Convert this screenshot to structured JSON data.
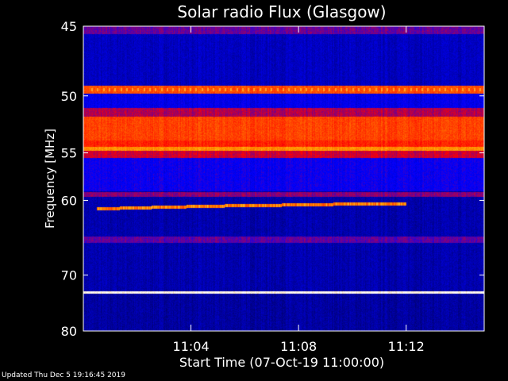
{
  "chart_data": {
    "type": "heatmap",
    "title": "Solar radio Flux (Glasgow)",
    "xlabel": "Start Time (07-Oct-19 11:00:00)",
    "ylabel": "Frequency [MHz]",
    "xlim_minutes": [
      0,
      14.9
    ],
    "ylim_mhz": [
      80,
      45
    ],
    "y_scale": "reciprocal",
    "x_ticks": [
      {
        "minute": 4,
        "label": "11:04"
      },
      {
        "minute": 8,
        "label": "11:08"
      },
      {
        "minute": 12,
        "label": "11:12"
      }
    ],
    "y_ticks": [
      {
        "mhz": 45,
        "label": "45"
      },
      {
        "mhz": 50,
        "label": "50"
      },
      {
        "mhz": 55,
        "label": "55"
      },
      {
        "mhz": 60,
        "label": "60"
      },
      {
        "mhz": 70,
        "label": "70"
      },
      {
        "mhz": 80,
        "label": "80"
      }
    ],
    "colormap": [
      "#000060",
      "#0000ff",
      "#ff0000",
      "#ffa000",
      "#ffffff"
    ],
    "bands": [
      {
        "from_mhz": 45.0,
        "to_mhz": 45.5,
        "level": 0.35
      },
      {
        "from_mhz": 45.5,
        "to_mhz": 49.5,
        "level": 0.15
      },
      {
        "from_mhz": 49.2,
        "to_mhz": 49.8,
        "level": 0.62
      },
      {
        "from_mhz": 49.8,
        "to_mhz": 51.0,
        "level": 0.22
      },
      {
        "from_mhz": 51.0,
        "to_mhz": 51.7,
        "level": 0.42
      },
      {
        "from_mhz": 51.7,
        "to_mhz": 53.8,
        "level": 0.6
      },
      {
        "from_mhz": 53.8,
        "to_mhz": 54.4,
        "level": 0.55
      },
      {
        "from_mhz": 54.4,
        "to_mhz": 54.8,
        "level": 0.72
      },
      {
        "from_mhz": 54.8,
        "to_mhz": 55.5,
        "level": 0.45
      },
      {
        "from_mhz": 55.5,
        "to_mhz": 59.0,
        "level": 0.25
      },
      {
        "from_mhz": 59.1,
        "to_mhz": 59.6,
        "level": 0.38
      },
      {
        "from_mhz": 59.6,
        "to_mhz": 64.5,
        "level": 0.12
      },
      {
        "from_mhz": 64.5,
        "to_mhz": 65.3,
        "level": 0.34
      },
      {
        "from_mhz": 65.3,
        "to_mhz": 72.5,
        "level": 0.12
      },
      {
        "from_mhz": 72.6,
        "to_mhz": 73.1,
        "level": 0.98
      },
      {
        "from_mhz": 73.1,
        "to_mhz": 80.0,
        "level": 0.1
      }
    ],
    "traces": [
      {
        "minutes": [
          0.5,
          3.0,
          6.0,
          9.3
        ],
        "mhz": [
          61.0,
          60.8,
          60.6,
          60.5
        ],
        "level": 0.7
      },
      {
        "minutes": [
          9.3,
          12.0
        ],
        "mhz": [
          60.4,
          60.4
        ],
        "level": 0.7
      }
    ]
  },
  "footer": {
    "updated": "Updated Thu Dec  5 19:16:45 2019"
  }
}
